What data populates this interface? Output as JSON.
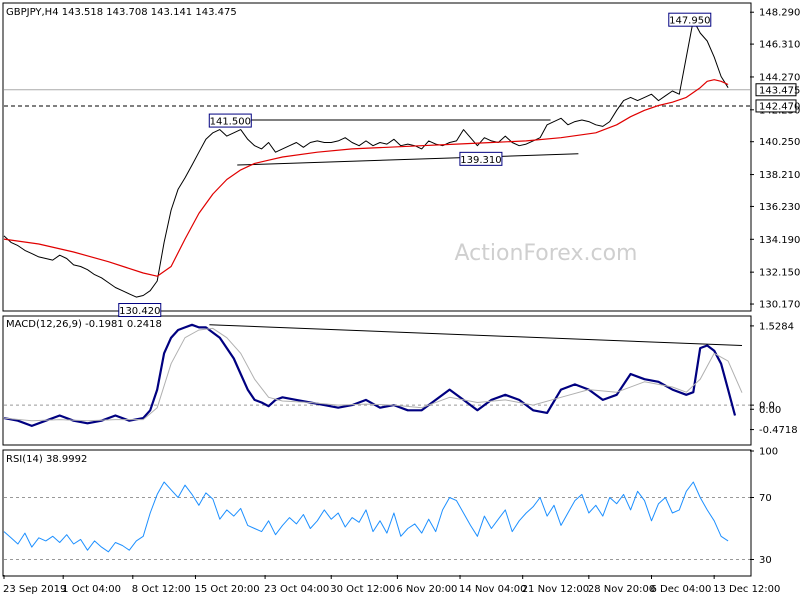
{
  "chart_data": [
    {
      "type": "line",
      "panel": "price",
      "header": "GBPJPY,H4  143.518 143.708 143.141 143.475",
      "ylim": [
        129.8,
        148.8
      ],
      "y_ticks": [
        "148.290",
        "146.310",
        "144.270",
        "142.230",
        "140.250",
        "138.210",
        "136.230",
        "134.190",
        "132.150",
        "130.170"
      ],
      "y_tick_values": [
        148.29,
        146.31,
        144.27,
        142.23,
        140.25,
        138.21,
        136.23,
        134.19,
        132.15,
        130.17
      ],
      "last_price": 143.475,
      "last_price_label": "143.475",
      "support_level": 142.47,
      "support_label": "142.470",
      "annotations": [
        {
          "label": "147.950",
          "x": 98.5,
          "y": 147.95
        },
        {
          "label": "141.500",
          "x": 32.5,
          "y": 141.5
        },
        {
          "label": "139.310",
          "x": 68.5,
          "y": 139.31
        },
        {
          "label": "130.420",
          "x": 19.5,
          "y": 130.42
        }
      ],
      "trendlines": [
        {
          "x": [
            33.5,
            78.5
          ],
          "y": [
            141.6,
            141.6
          ]
        },
        {
          "x": [
            33.5,
            82.5
          ],
          "y": [
            138.8,
            139.5
          ]
        }
      ],
      "series": [
        {
          "role": "price",
          "color": "#000000",
          "x": [
            0,
            1,
            2,
            3,
            4,
            5,
            6,
            7,
            8,
            9,
            10,
            11,
            12,
            13,
            14,
            15,
            16,
            17,
            18,
            19,
            20,
            21,
            22,
            23,
            24,
            25,
            26,
            27,
            28,
            29,
            30,
            31,
            32,
            33,
            34,
            35,
            36,
            37,
            38,
            39,
            40,
            41,
            42,
            43,
            44,
            45,
            46,
            47,
            48,
            49,
            50,
            51,
            52,
            53,
            54,
            55,
            56,
            57,
            58,
            59,
            60,
            61,
            62,
            63,
            64,
            65,
            66,
            67,
            68,
            69,
            70,
            71,
            72,
            73,
            74,
            75,
            76,
            77,
            78,
            79,
            80,
            81,
            82,
            83,
            84,
            85,
            86,
            87,
            88,
            89,
            90,
            91,
            92,
            93,
            94,
            95,
            96,
            97,
            98,
            99,
            100,
            101,
            102,
            103,
            104
          ],
          "values": [
            134.4,
            134.0,
            133.8,
            133.5,
            133.3,
            133.1,
            133.0,
            132.9,
            133.2,
            133.0,
            132.6,
            132.5,
            132.3,
            132.0,
            131.8,
            131.5,
            131.2,
            131.0,
            130.8,
            130.6,
            130.7,
            131.0,
            131.6,
            134.0,
            136.0,
            137.3,
            138.0,
            138.8,
            139.6,
            140.4,
            140.8,
            141.0,
            140.6,
            140.8,
            141.0,
            140.4,
            140.0,
            139.8,
            140.2,
            139.6,
            139.8,
            140.0,
            140.2,
            139.9,
            140.2,
            140.3,
            140.2,
            140.2,
            140.3,
            140.5,
            140.2,
            140.0,
            140.3,
            140.0,
            140.2,
            140.1,
            140.4,
            140.0,
            140.1,
            140.0,
            139.8,
            140.3,
            140.1,
            140.0,
            140.2,
            140.3,
            141.0,
            140.5,
            140.0,
            140.5,
            140.3,
            140.2,
            140.6,
            140.2,
            140.0,
            140.1,
            140.3,
            140.5,
            141.3,
            141.5,
            141.7,
            141.3,
            141.5,
            141.6,
            141.5,
            141.3,
            141.2,
            141.5,
            142.2,
            142.8,
            143.0,
            142.8,
            143.0,
            143.2,
            142.8,
            143.1,
            143.4,
            143.2,
            145.5,
            147.8,
            147.0,
            146.5,
            145.5,
            144.3,
            143.6
          ]
        },
        {
          "role": "moving-average",
          "color": "#e00000",
          "x": [
            0,
            5,
            10,
            15,
            20,
            22,
            24,
            26,
            28,
            30,
            32,
            34,
            36,
            38,
            40,
            45,
            50,
            55,
            60,
            65,
            70,
            75,
            80,
            85,
            88,
            90,
            92,
            94,
            96,
            98,
            100,
            101,
            102,
            103,
            104
          ],
          "values": [
            134.2,
            133.9,
            133.4,
            132.8,
            132.1,
            131.9,
            132.5,
            134.2,
            135.8,
            137.0,
            137.9,
            138.5,
            138.9,
            139.1,
            139.3,
            139.6,
            139.8,
            139.9,
            140.0,
            140.1,
            140.2,
            140.3,
            140.5,
            140.8,
            141.3,
            141.8,
            142.2,
            142.5,
            142.7,
            143.0,
            143.6,
            144.0,
            144.1,
            144.0,
            143.8
          ]
        }
      ]
    },
    {
      "type": "line",
      "panel": "macd",
      "header": "MACD(12,26,9) -0.1981 0.2418",
      "ylim": [
        -0.75,
        1.7
      ],
      "y_ticks": [
        "1.5284",
        "0.0",
        "0.00",
        "-0.4718"
      ],
      "y_tick_values": [
        1.5284,
        0.0,
        -0.08,
        -0.4718
      ],
      "trendlines": [
        {
          "x": [
            29.5,
            106
          ],
          "y": [
            1.55,
            1.15
          ]
        }
      ],
      "series": [
        {
          "role": "macd",
          "color": "#000080",
          "x": [
            0,
            2,
            4,
            6,
            8,
            10,
            12,
            14,
            16,
            18,
            20,
            21,
            22,
            23,
            24,
            25,
            26,
            27,
            28,
            29,
            30,
            31,
            32,
            33,
            34,
            35,
            36,
            37,
            38,
            39,
            40,
            42,
            44,
            46,
            48,
            50,
            52,
            54,
            56,
            58,
            60,
            62,
            64,
            66,
            68,
            70,
            72,
            74,
            76,
            78,
            80,
            82,
            84,
            86,
            88,
            90,
            92,
            94,
            96,
            98,
            99,
            100,
            101,
            102,
            103,
            104,
            105
          ],
          "values": [
            -0.25,
            -0.3,
            -0.4,
            -0.3,
            -0.2,
            -0.3,
            -0.35,
            -0.3,
            -0.2,
            -0.3,
            -0.25,
            -0.1,
            0.3,
            1.0,
            1.3,
            1.45,
            1.5,
            1.55,
            1.5,
            1.5,
            1.4,
            1.3,
            1.1,
            0.9,
            0.6,
            0.3,
            0.1,
            0.05,
            -0.02,
            0.1,
            0.15,
            0.1,
            0.05,
            0.0,
            -0.05,
            0.0,
            0.1,
            -0.05,
            0.0,
            -0.1,
            -0.1,
            0.1,
            0.3,
            0.1,
            -0.1,
            0.1,
            0.2,
            0.1,
            -0.1,
            -0.15,
            0.3,
            0.4,
            0.3,
            0.1,
            0.2,
            0.6,
            0.5,
            0.45,
            0.3,
            0.2,
            0.25,
            1.1,
            1.15,
            1.05,
            0.8,
            0.3,
            -0.2
          ]
        },
        {
          "role": "signal",
          "color": "#b0b0b0",
          "x": [
            0,
            4,
            8,
            12,
            16,
            20,
            22,
            24,
            26,
            28,
            30,
            32,
            34,
            36,
            38,
            40,
            44,
            48,
            52,
            56,
            60,
            64,
            68,
            72,
            76,
            80,
            84,
            88,
            92,
            96,
            98,
            100,
            102,
            104,
            106
          ],
          "values": [
            -0.25,
            -0.3,
            -0.28,
            -0.3,
            -0.28,
            -0.28,
            -0.05,
            0.8,
            1.3,
            1.45,
            1.48,
            1.3,
            1.0,
            0.5,
            0.15,
            0.08,
            0.05,
            0.0,
            0.02,
            0.0,
            -0.05,
            0.15,
            0.05,
            0.1,
            0.0,
            0.15,
            0.3,
            0.25,
            0.45,
            0.35,
            0.25,
            0.5,
            1.0,
            0.85,
            0.24
          ]
        }
      ]
    },
    {
      "type": "line",
      "panel": "rsi",
      "header": "RSI(14) 38.9992",
      "ylim": [
        20,
        100
      ],
      "y_ticks": [
        "100",
        "70",
        "30"
      ],
      "y_tick_values": [
        100,
        70,
        30
      ],
      "levels": [
        70,
        30
      ],
      "x_ticks": [
        "23 Sep 2019",
        "1 Oct 04:00",
        "8 Oct 12:00",
        "15 Oct 20:00",
        "23 Oct 04:00",
        "30 Oct 12:00",
        "6 Nov 20:00",
        "14 Nov 04:00",
        "21 Nov 12:00",
        "28 Nov 20:00",
        "6 Dec 04:00",
        "13 Dec 12:00"
      ],
      "x_tick_positions": [
        0,
        8.5,
        18.5,
        27.5,
        37.5,
        47,
        56.5,
        65.5,
        74.5,
        84,
        93,
        102
      ],
      "series": [
        {
          "role": "rsi",
          "color": "#1e90ff",
          "x": [
            0,
            1,
            2,
            3,
            4,
            5,
            6,
            7,
            8,
            9,
            10,
            11,
            12,
            13,
            14,
            15,
            16,
            17,
            18,
            19,
            20,
            21,
            22,
            23,
            24,
            25,
            26,
            27,
            28,
            29,
            30,
            31,
            32,
            33,
            34,
            35,
            36,
            37,
            38,
            39,
            40,
            41,
            42,
            43,
            44,
            45,
            46,
            47,
            48,
            49,
            50,
            51,
            52,
            53,
            54,
            55,
            56,
            57,
            58,
            59,
            60,
            61,
            62,
            63,
            64,
            65,
            66,
            67,
            68,
            69,
            70,
            71,
            72,
            73,
            74,
            75,
            76,
            77,
            78,
            79,
            80,
            81,
            82,
            83,
            84,
            85,
            86,
            87,
            88,
            89,
            90,
            91,
            92,
            93,
            94,
            95,
            96,
            97,
            98,
            99,
            100,
            101,
            102,
            103,
            104
          ],
          "values": [
            48,
            44,
            40,
            47,
            38,
            44,
            42,
            45,
            41,
            46,
            40,
            43,
            36,
            42,
            38,
            35,
            41,
            39,
            36,
            42,
            45,
            60,
            72,
            80,
            75,
            70,
            78,
            72,
            65,
            73,
            69,
            56,
            62,
            58,
            63,
            52,
            50,
            48,
            55,
            46,
            52,
            57,
            53,
            59,
            50,
            55,
            62,
            56,
            60,
            51,
            57,
            54,
            62,
            48,
            55,
            47,
            60,
            45,
            50,
            53,
            47,
            56,
            48,
            62,
            70,
            68,
            60,
            52,
            45,
            58,
            50,
            56,
            62,
            48,
            55,
            60,
            64,
            70,
            58,
            65,
            52,
            60,
            68,
            72,
            60,
            65,
            58,
            70,
            66,
            72,
            62,
            74,
            68,
            55,
            66,
            70,
            60,
            62,
            74,
            80,
            70,
            62,
            55,
            45,
            42
          ]
        }
      ]
    }
  ],
  "watermark": "ActionForex.com"
}
